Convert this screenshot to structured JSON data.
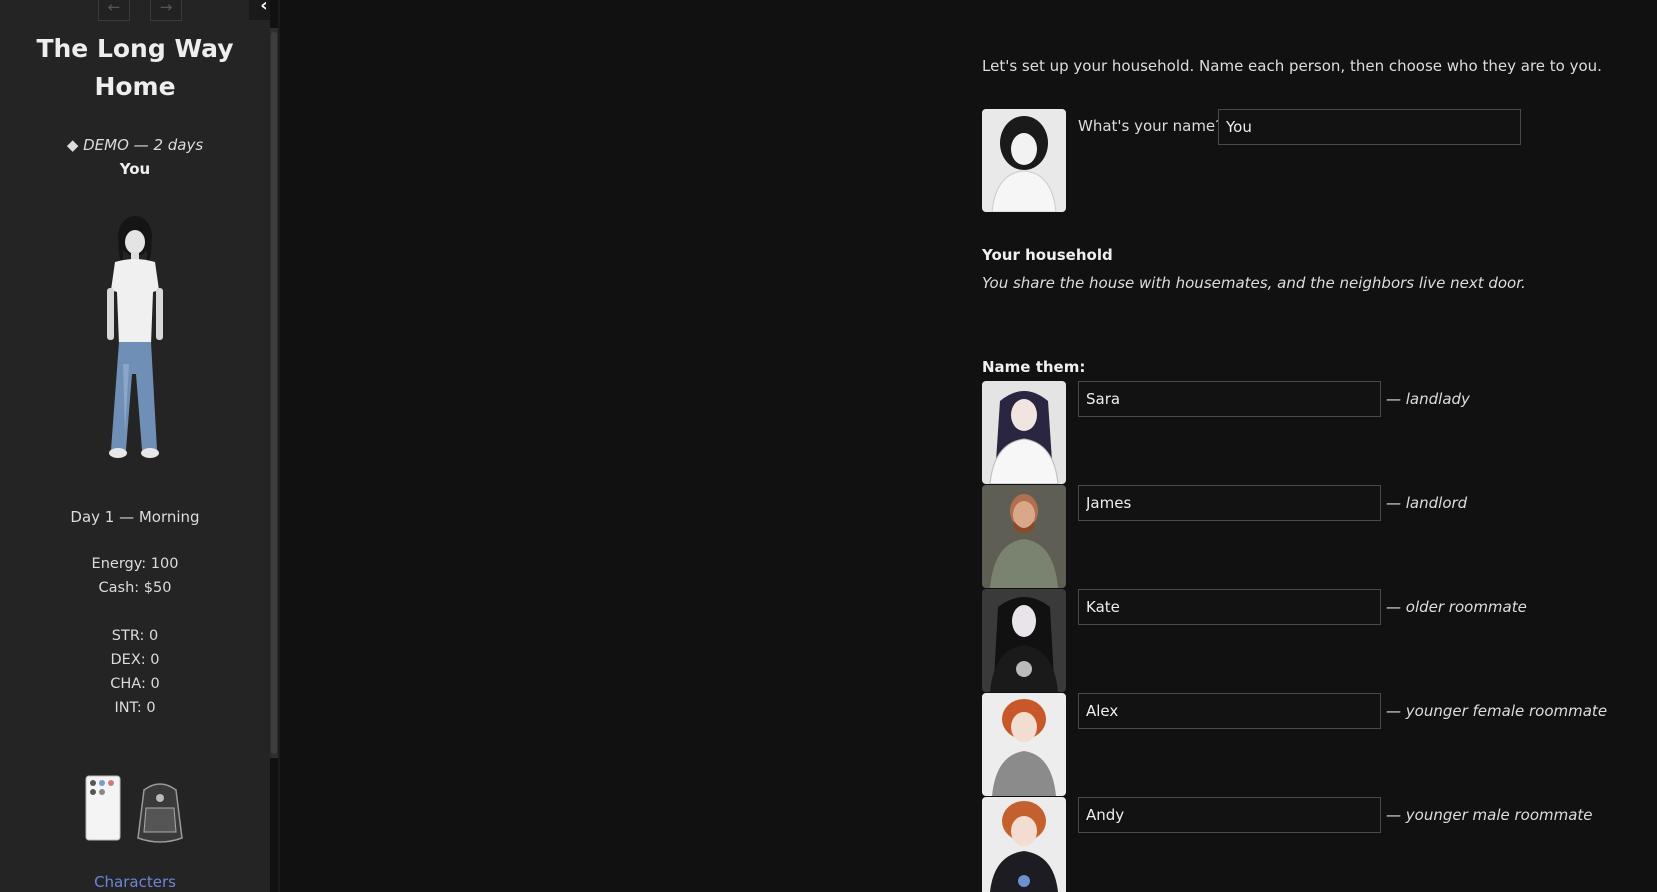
{
  "sidebar": {
    "back_icon": "arrow-left-icon",
    "forward_icon": "arrow-right-icon",
    "collapse_icon": "chevron-left-icon",
    "title": "The Long Way Home",
    "demo_text": "◆ DEMO — 2 days",
    "player_name": "You",
    "day_time": "Day 1 — Morning",
    "energy": "Energy: 100",
    "cash": "Cash: $50",
    "stats": [
      "STR: 0",
      "DEX: 0",
      "CHA: 0",
      "INT: 0"
    ],
    "items": [
      "phone-icon",
      "backpack-icon"
    ],
    "characters_link": "Characters"
  },
  "main": {
    "intro": "Let's set up your household. Name each person, then choose who they are to you.",
    "name_label": "What's your name?",
    "name_value": "You",
    "household_heading": "Your household",
    "household_desc": "You share the house with housemates, and the neighbors live next door.",
    "name_them_label": "Name them:",
    "people": [
      {
        "name": "Sara",
        "role": "— landlady"
      },
      {
        "name": "James",
        "role": "— landlord"
      },
      {
        "name": "Kate",
        "role": "— older roommate"
      },
      {
        "name": "Alex",
        "role": "— younger female roommate"
      },
      {
        "name": "Andy",
        "role": "— younger male roommate"
      }
    ]
  },
  "colors": {
    "background": "#111111",
    "sidebar": "#242424",
    "link": "#6e86d8"
  }
}
